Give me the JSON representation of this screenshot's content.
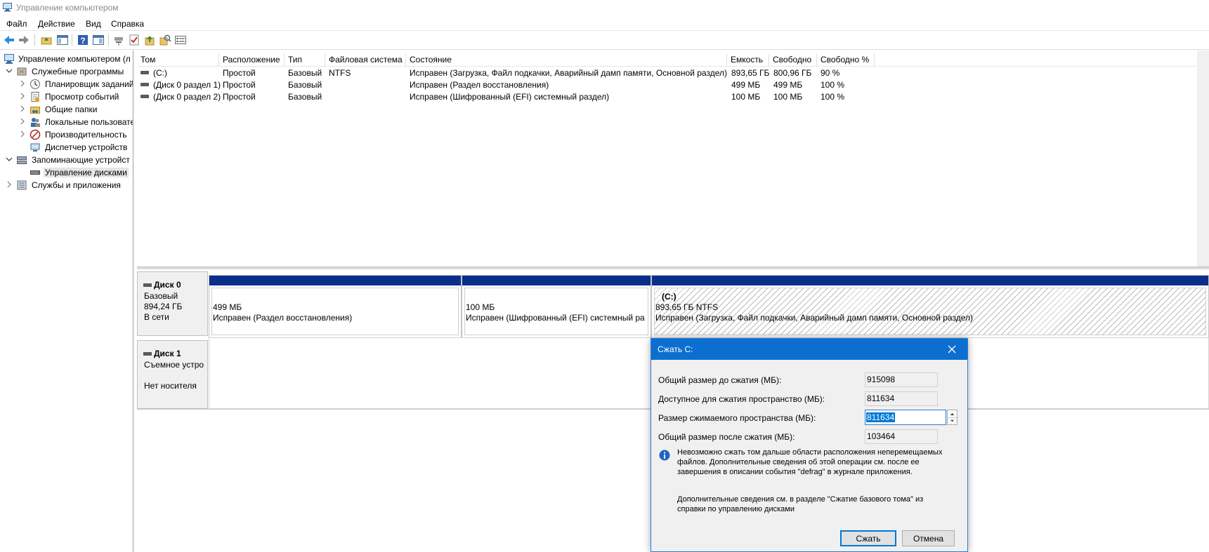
{
  "window": {
    "title": "Управление компьютером",
    "icon": "computer-management-icon"
  },
  "menu": [
    "Файл",
    "Действие",
    "Вид",
    "Справка"
  ],
  "toolbar": {
    "icons": [
      "back-arrow-icon",
      "forward-arrow-icon",
      "up-folder-icon",
      "show-hide-tree-icon",
      "help-icon",
      "action-pane-icon",
      "connect-disk-icon",
      "check-icon",
      "folder-up-icon",
      "search-icon",
      "properties-icon"
    ]
  },
  "tree": [
    {
      "label": "Управление компьютером (л",
      "icon": "computer-management-icon",
      "level": 0,
      "expanded": true
    },
    {
      "label": "Служебные программы",
      "icon": "system-tools-icon",
      "level": 1,
      "expanded": true
    },
    {
      "label": "Планировщик заданий",
      "icon": "task-scheduler-icon",
      "level": 2,
      "expanded": false
    },
    {
      "label": "Просмотр событий",
      "icon": "event-viewer-icon",
      "level": 2,
      "expanded": false
    },
    {
      "label": "Общие папки",
      "icon": "shared-folders-icon",
      "level": 2,
      "expanded": false
    },
    {
      "label": "Локальные пользовате",
      "icon": "local-users-icon",
      "level": 2,
      "expanded": false
    },
    {
      "label": "Производительность",
      "icon": "performance-icon",
      "level": 2,
      "expanded": false
    },
    {
      "label": "Диспетчер устройств",
      "icon": "device-manager-icon",
      "level": 2,
      "expanded": null
    },
    {
      "label": "Запоминающие устройст",
      "icon": "storage-icon",
      "level": 1,
      "expanded": true
    },
    {
      "label": "Управление дисками",
      "icon": "disk-management-icon",
      "level": 2,
      "expanded": null,
      "selected": true
    },
    {
      "label": "Службы и приложения",
      "icon": "services-apps-icon",
      "level": 1,
      "expanded": false
    }
  ],
  "volumes": {
    "columns": [
      "Том",
      "Расположение",
      "Тип",
      "Файловая система",
      "Состояние",
      "Емкость",
      "Свободно",
      "Свободно %"
    ],
    "rows": [
      [
        "(C:)",
        "Простой",
        "Базовый",
        "NTFS",
        "Исправен (Загрузка, Файл подкачки, Аварийный дамп памяти, Основной раздел)",
        "893,65 ГБ",
        "800,96 ГБ",
        "90 %"
      ],
      [
        "(Диск 0 раздел 1)",
        "Простой",
        "Базовый",
        "",
        "Исправен (Раздел восстановления)",
        "499 МБ",
        "499 МБ",
        "100 %"
      ],
      [
        "(Диск 0 раздел 2)",
        "Простой",
        "Базовый",
        "",
        "Исправен (Шифрованный (EFI) системный раздел)",
        "100 МБ",
        "100 МБ",
        "100 %"
      ]
    ]
  },
  "disks": [
    {
      "name": "Диск 0",
      "lines": [
        "Базовый",
        "894,24 ГБ",
        "В сети"
      ],
      "partitions": [
        {
          "name": "",
          "size": "499 МБ",
          "status": "Исправен (Раздел восстановления)"
        },
        {
          "name": "",
          "size": "100 МБ",
          "status": "Исправен (Шифрованный (EFI) системный ра"
        },
        {
          "name": "(C:)",
          "size": "893,65 ГБ NTFS",
          "status": "Исправен (Загрузка, Файл подкачки, Аварийный дамп памяти, Основной раздел)"
        }
      ]
    },
    {
      "name": "Диск 1",
      "lines": [
        "Съемное устро",
        "",
        "Нет носителя"
      ]
    }
  ],
  "dialog": {
    "title": "Сжать C:",
    "fields": [
      {
        "label": "Общий размер до сжатия (МБ):",
        "value": "915098",
        "editable": false
      },
      {
        "label": "Доступное для сжатия пространство (МБ):",
        "value": "811634",
        "editable": false
      },
      {
        "label": "Размер сжимаемого пространства (МБ):",
        "value": "811634",
        "editable": true
      },
      {
        "label": "Общий размер после сжатия (МБ):",
        "value": "103464",
        "editable": false
      }
    ],
    "info_text": "Невозможно сжать том дальше области расположения неперемещаемых\nфайлов. Дополнительные сведения об этой операции см. после ее\nзавершения в описании события \"defrag\" в журнале приложения.",
    "help_text": "Дополнительные сведения см. в разделе \"Сжатие базового тома\" из\nсправки по управлению дисками",
    "buttons": {
      "ok": "Сжать",
      "cancel": "Отмена"
    }
  },
  "colors": {
    "accent": "#0c6fd0",
    "partition_band": "#0a2e8b",
    "selection": "#0078d7"
  }
}
